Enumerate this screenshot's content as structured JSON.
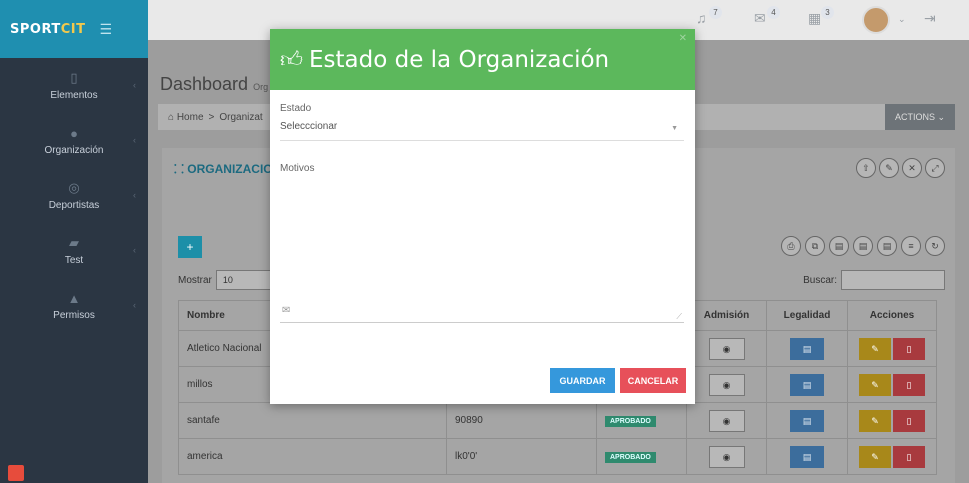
{
  "brand": {
    "logo_main": "SPORT",
    "logo_accent": "CIT"
  },
  "sidebar": {
    "items": [
      {
        "label": "Elementos",
        "icon": "tablet-icon"
      },
      {
        "label": "Organización",
        "icon": "globe-icon"
      },
      {
        "label": "Deportistas",
        "icon": "soccer-ball-icon"
      },
      {
        "label": "Test",
        "icon": "book-icon"
      },
      {
        "label": "Permisos",
        "icon": "lock-icon"
      }
    ]
  },
  "topbar": {
    "notifications_count": "7",
    "messages_count": "4",
    "tasks_count": "3"
  },
  "page": {
    "title": "Dashboard",
    "subtitle": "Org",
    "breadcrumb_home": "Home",
    "breadcrumb_sep": ">",
    "breadcrumb_current": "Organizat",
    "actions_label": "ACTIONS ⌄"
  },
  "portlet": {
    "title": "ORGANIZACIO",
    "show_label": "Mostrar",
    "show_value": "10",
    "search_label": "Buscar:"
  },
  "table": {
    "headers": {
      "name": "Nombre",
      "admission": "Admisión",
      "legality": "Legalidad",
      "actions": "Acciones"
    },
    "rows": [
      {
        "name": "Atletico Nacional",
        "code": "",
        "status": ""
      },
      {
        "name": "millos",
        "code": "",
        "status": ""
      },
      {
        "name": "santafe",
        "code": "90890",
        "status": "APROBADO"
      },
      {
        "name": "america",
        "code": "lk0'0'",
        "status": "APROBADO"
      }
    ]
  },
  "modal": {
    "title": "Estado de la Organización",
    "estado_label": "Estado",
    "estado_value": "Selecccionar",
    "motivos_label": "Motivos",
    "save_label": "GUARDAR",
    "cancel_label": "CANCELAR",
    "header_color": "#5cb85c"
  }
}
